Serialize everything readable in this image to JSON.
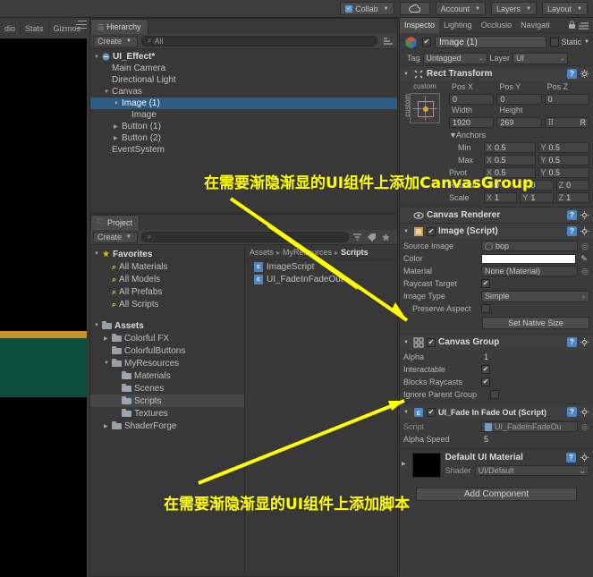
{
  "toolbar": {
    "collab": "Collab",
    "cloud_icon": "cloud-icon",
    "account": "Account",
    "layers": "Layers",
    "layout": "Layout"
  },
  "game_view": {
    "tabs": [
      "dio",
      "Stats",
      "Gizmos"
    ],
    "colors": {
      "background": "#000000",
      "bar": "#c8912a",
      "panel": "#0c4f3d"
    }
  },
  "hierarchy": {
    "tab": "Hierarchy",
    "create_label": "Create",
    "search_placeholder": "All",
    "items": [
      {
        "label": "UI_Effect*",
        "depth": 0,
        "arrow": "▼",
        "icon": "scene-icon",
        "bold": true,
        "selected": false
      },
      {
        "label": "Main Camera",
        "depth": 1,
        "arrow": "",
        "icon": "",
        "bold": false,
        "selected": false
      },
      {
        "label": "Directional Light",
        "depth": 1,
        "arrow": "",
        "icon": "",
        "bold": false,
        "selected": false
      },
      {
        "label": "Canvas",
        "depth": 1,
        "arrow": "▼",
        "icon": "",
        "bold": false,
        "selected": false
      },
      {
        "label": "Image (1)",
        "depth": 2,
        "arrow": "▼",
        "icon": "",
        "bold": false,
        "selected": true
      },
      {
        "label": "Image",
        "depth": 3,
        "arrow": "",
        "icon": "",
        "bold": false,
        "selected": false
      },
      {
        "label": "Button (1)",
        "depth": 2,
        "arrow": "▶",
        "icon": "",
        "bold": false,
        "selected": false
      },
      {
        "label": "Button (2)",
        "depth": 2,
        "arrow": "▶",
        "icon": "",
        "bold": false,
        "selected": false
      },
      {
        "label": "EventSystem",
        "depth": 1,
        "arrow": "",
        "icon": "",
        "bold": false,
        "selected": false
      }
    ]
  },
  "project": {
    "tab": "Project",
    "create_label": "Create",
    "search_placeholder": "",
    "tree": [
      {
        "label": "Favorites",
        "depth": 0,
        "arrow": "▼",
        "icon": "star-icon",
        "bold": true,
        "selected": false
      },
      {
        "label": "All Materials",
        "depth": 1,
        "arrow": "",
        "icon": "search-icon",
        "bold": false,
        "selected": false
      },
      {
        "label": "All Models",
        "depth": 1,
        "arrow": "",
        "icon": "search-icon",
        "bold": false,
        "selected": false
      },
      {
        "label": "All Prefabs",
        "depth": 1,
        "arrow": "",
        "icon": "search-icon",
        "bold": false,
        "selected": false
      },
      {
        "label": "All Scripts",
        "depth": 1,
        "arrow": "",
        "icon": "search-icon",
        "bold": false,
        "selected": false
      },
      {
        "label": "",
        "depth": 0,
        "arrow": "",
        "icon": "",
        "bold": false,
        "selected": false
      },
      {
        "label": "Assets",
        "depth": 0,
        "arrow": "▼",
        "icon": "folder-icon",
        "bold": true,
        "selected": false
      },
      {
        "label": "Colorful FX",
        "depth": 1,
        "arrow": "▶",
        "icon": "folder-icon",
        "bold": false,
        "selected": false
      },
      {
        "label": "ColorfulButtons",
        "depth": 1,
        "arrow": "",
        "icon": "folder-icon",
        "bold": false,
        "selected": false
      },
      {
        "label": "MyResources",
        "depth": 1,
        "arrow": "▼",
        "icon": "folder-icon",
        "bold": false,
        "selected": false
      },
      {
        "label": "Materials",
        "depth": 2,
        "arrow": "",
        "icon": "folder-icon",
        "bold": false,
        "selected": false
      },
      {
        "label": "Scenes",
        "depth": 2,
        "arrow": "",
        "icon": "folder-icon",
        "bold": false,
        "selected": false
      },
      {
        "label": "Scripts",
        "depth": 2,
        "arrow": "",
        "icon": "folder-icon",
        "bold": false,
        "selected": true
      },
      {
        "label": "Textures",
        "depth": 2,
        "arrow": "",
        "icon": "folder-icon",
        "bold": false,
        "selected": false
      },
      {
        "label": "ShaderForge",
        "depth": 1,
        "arrow": "▶",
        "icon": "folder-icon",
        "bold": false,
        "selected": false
      }
    ],
    "breadcrumb": [
      "Assets",
      "MyResources",
      "Scripts"
    ],
    "assets": [
      {
        "name": "ImageScript",
        "icon": "csharp-script-icon"
      },
      {
        "name": "UI_FadeInFadeOut",
        "icon": "csharp-script-icon"
      }
    ]
  },
  "inspector": {
    "tabs": [
      "Inspecto",
      "Lighting",
      "Occlusio",
      "Navigati"
    ],
    "selected_tab": "Inspecto",
    "gameobject": {
      "name": "Image (1)",
      "enabled": true,
      "static_label": "Static",
      "tag_label": "Tag",
      "tag_value": "Untagged",
      "layer_label": "Layer",
      "layer_value": "UI"
    },
    "rect_transform": {
      "title": "Rect Transform",
      "anchor_preset_top": "custom",
      "anchor_preset_side": "custom",
      "pos_x_label": "Pos X",
      "pos_x": "0",
      "pos_y_label": "Pos Y",
      "pos_y": "0",
      "pos_z_label": "Pos Z",
      "pos_z": "0",
      "width_label": "Width",
      "width": "1920",
      "height_label": "Height",
      "height": "269",
      "blueprint_label": "R",
      "anchors_label": "Anchors",
      "min_label": "Min",
      "min_x": "0.5",
      "min_y": "0.5",
      "max_label": "Max",
      "max_x": "0.5",
      "max_y": "0.5",
      "pivot_label": "Pivot",
      "pivot_x": "0.5",
      "pivot_y": "0.5",
      "rotation_label": "Rotation",
      "rot_x": "0",
      "rot_y": "0",
      "rot_z": "0",
      "scale_label": "Scale",
      "scale_x": "1",
      "scale_y": "1",
      "scale_z": "1",
      "axis_x": "X",
      "axis_y": "Y",
      "axis_z": "Z"
    },
    "canvas_renderer": {
      "title": "Canvas Renderer"
    },
    "image_script": {
      "title": "Image (Script)",
      "enabled": true,
      "source_image_label": "Source Image",
      "source_image_value": "bop",
      "color_label": "Color",
      "color_value": "#ffffff",
      "material_label": "Material",
      "material_value": "None (Material)",
      "raycast_label": "Raycast Target",
      "raycast_value": true,
      "image_type_label": "Image Type",
      "image_type_value": "Simple",
      "preserve_aspect_label": "Preserve Aspect",
      "preserve_aspect_value": false,
      "native_size_button": "Set Native Size"
    },
    "canvas_group": {
      "title": "Canvas Group",
      "enabled": true,
      "alpha_label": "Alpha",
      "alpha_value": "1",
      "interactable_label": "Interactable",
      "interactable_value": true,
      "blocks_raycasts_label": "Blocks Raycasts",
      "blocks_raycasts_value": true,
      "ignore_parent_label": "Ignore Parent Group",
      "ignore_parent_value": false
    },
    "fade_script": {
      "title": "UI_Fade In Fade Out (Script)",
      "enabled": true,
      "script_label": "Script",
      "script_value": "UI_FadeInFadeOu",
      "alpha_speed_label": "Alpha Speed",
      "alpha_speed_value": "5"
    },
    "material": {
      "title": "Default UI Material",
      "shader_label": "Shader",
      "shader_value": "UI/Default"
    },
    "add_component": "Add Component"
  },
  "annotations": [
    {
      "id": "anno1",
      "text": "在需要渐隐渐显的UI组件上添加CanvasGroup"
    },
    {
      "id": "anno2",
      "text": "在需要渐隐渐显的UI组件上添加脚本"
    }
  ],
  "colors": {
    "annotation": "#ffff00",
    "selection": "#2c5d87",
    "panel_bg": "#383838"
  }
}
